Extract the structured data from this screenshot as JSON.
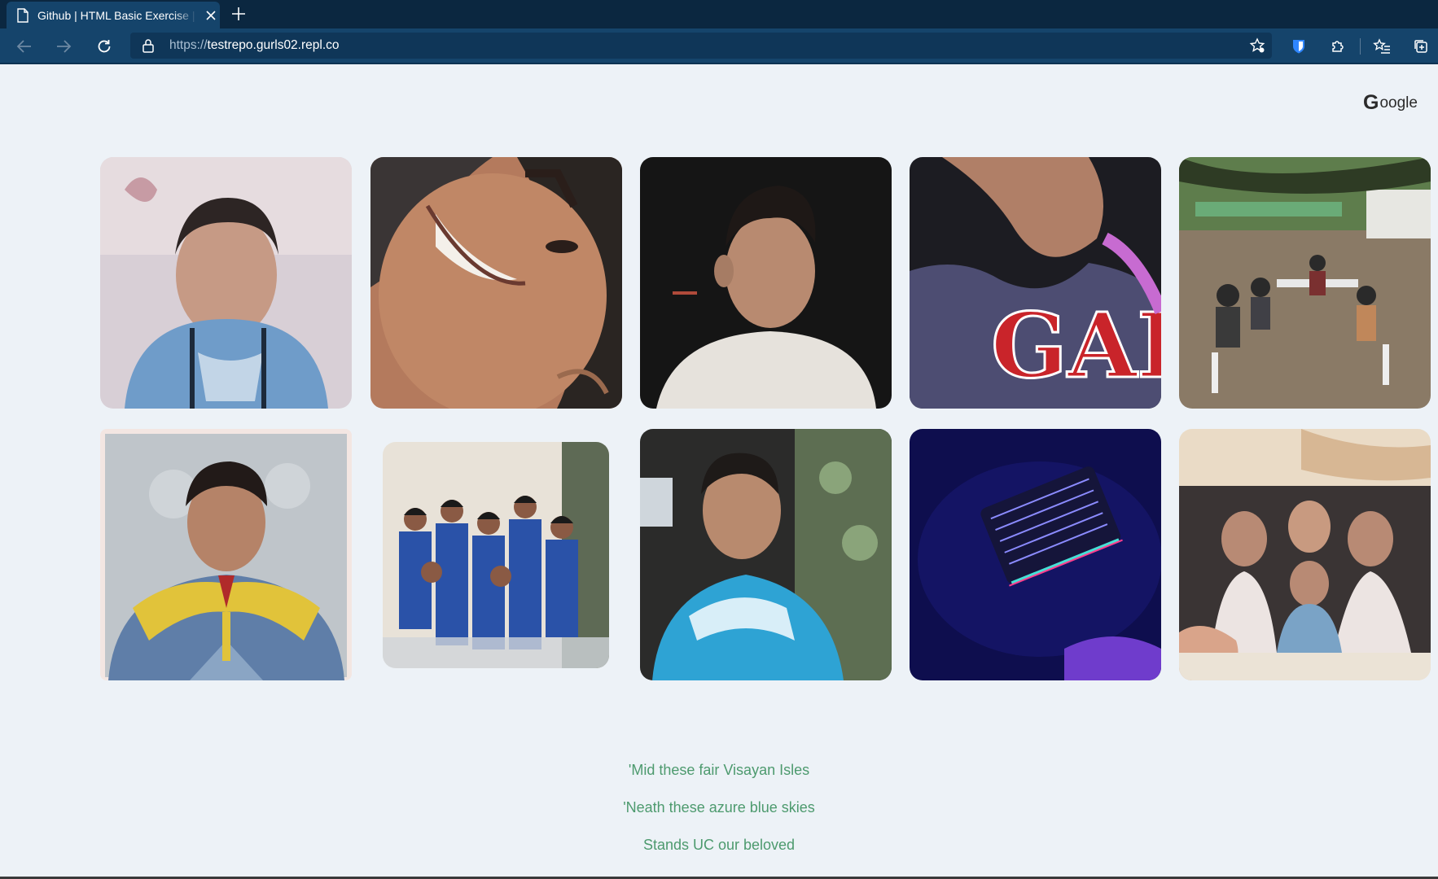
{
  "browser": {
    "tab_title": "Github | HTML Basic Exercise | AI",
    "url_protocol": "https://",
    "url_host": "testrepo.gurls02.repl.co",
    "tab_color": "#15446b",
    "frame_color": "#0b2740"
  },
  "page": {
    "google_letter": "G",
    "google_text": "oogle",
    "background": "#edf2f7",
    "lyric_color": "#4d9a6e"
  },
  "gallery": [
    {
      "subject": "portrait-young-boy-blue-shirt"
    },
    {
      "subject": "smiling-face-closeup"
    },
    {
      "subject": "boy-dark-background"
    },
    {
      "subject": "gap-shirt-selfie"
    },
    {
      "subject": "group-outdoor-tables"
    },
    {
      "subject": "graduation-portrait"
    },
    {
      "subject": "classmates-group-photo"
    },
    {
      "subject": "boy-blue-tshirt-indoor"
    },
    {
      "subject": "rgb-keyboard-dark"
    },
    {
      "subject": "family-photo-held-in-hand"
    }
  ],
  "lyrics": [
    "'Mid these fair Visayan Isles",
    "'Neath these azure blue skies",
    "Stands UC our beloved"
  ]
}
